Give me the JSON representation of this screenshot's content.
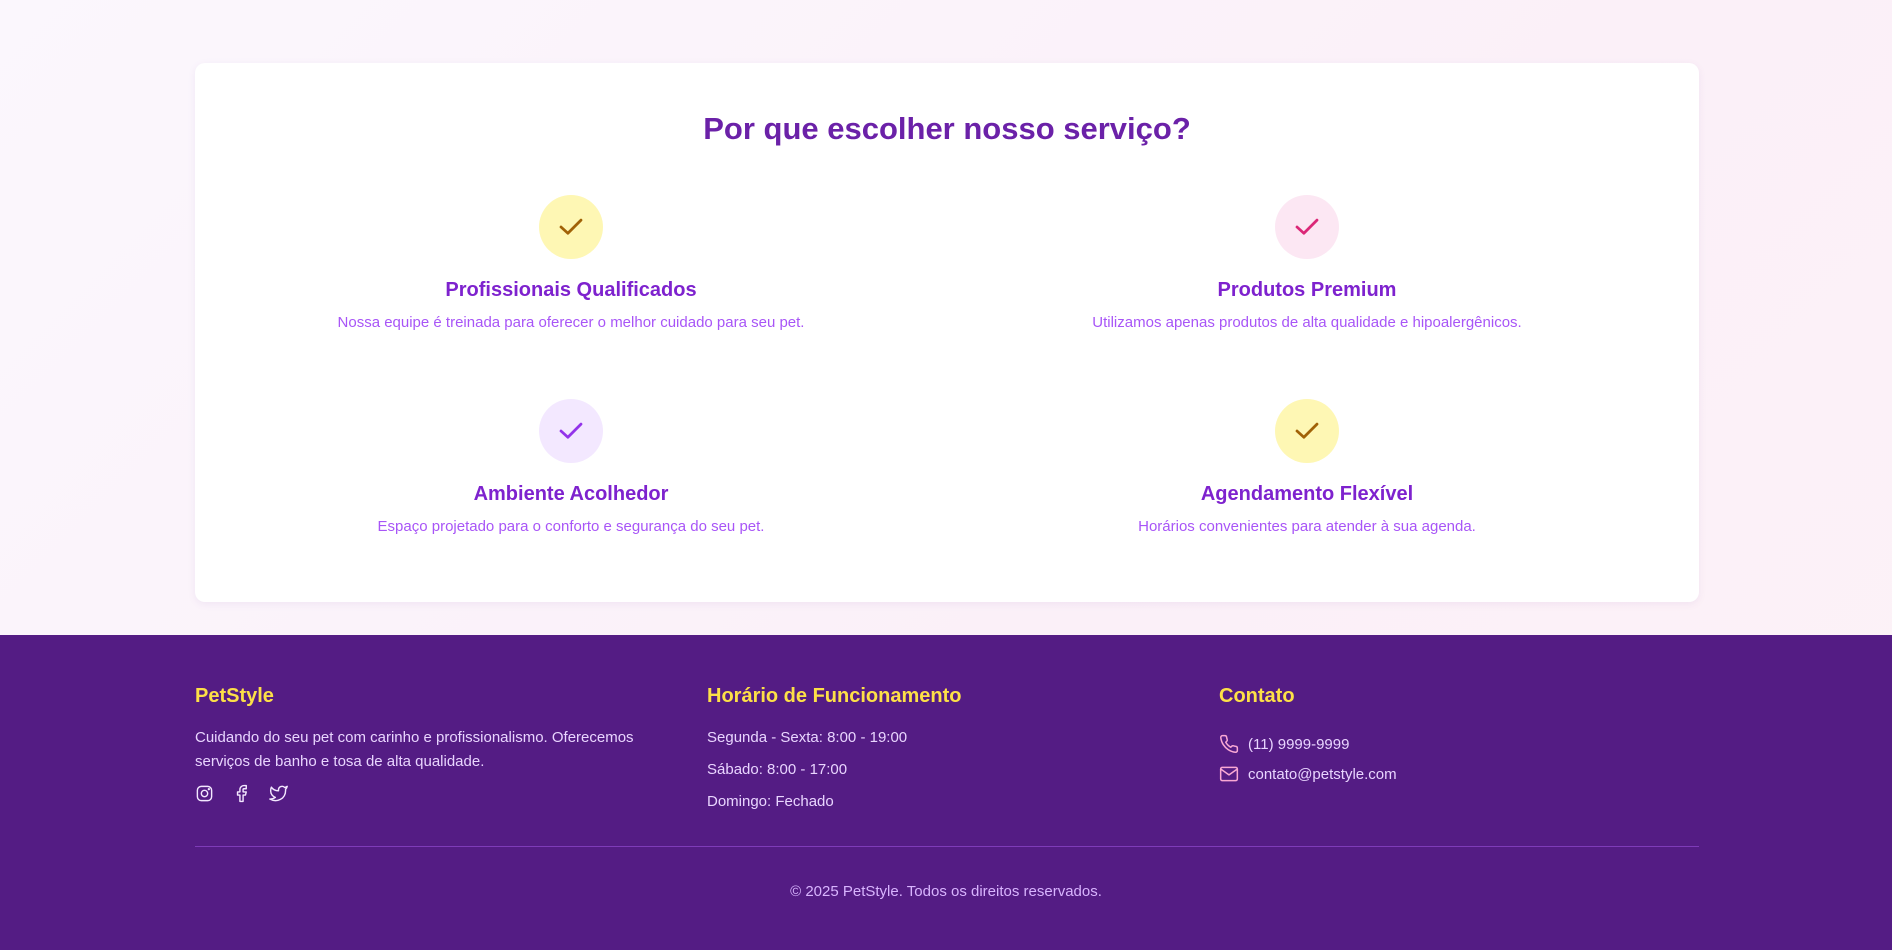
{
  "section": {
    "title": "Por que escolher nosso serviço?",
    "features": [
      {
        "title": "Profissionais Qualificados",
        "description": "Nossa equipe é treinada para oferecer o melhor cuidado para seu pet.",
        "icon": "check-icon",
        "badge_color": "#fef7b4",
        "check_color": "#a16207"
      },
      {
        "title": "Produtos Premium",
        "description": "Utilizamos apenas produtos de alta qualidade e hipoalergênicos.",
        "icon": "check-icon",
        "badge_color": "#fce7f3",
        "check_color": "#db2777"
      },
      {
        "title": "Ambiente Acolhedor",
        "description": "Espaço projetado para o conforto e segurança do seu pet.",
        "icon": "check-icon",
        "badge_color": "#f3e8ff",
        "check_color": "#9333ea"
      },
      {
        "title": "Agendamento Flexível",
        "description": "Horários convenientes para atender à sua agenda.",
        "icon": "check-icon",
        "badge_color": "#fef7b4",
        "check_color": "#a16207"
      }
    ]
  },
  "footer": {
    "brand": {
      "title": "PetStyle",
      "description": "Cuidando do seu pet com carinho e profissionalismo. Oferecemos serviços de banho e tosa de alta qualidade.",
      "socials": [
        "instagram-icon",
        "facebook-icon",
        "twitter-icon"
      ]
    },
    "hours": {
      "title": "Horário de Funcionamento",
      "lines": [
        "Segunda - Sexta: 8:00 - 19:00",
        "Sábado: 8:00 - 17:00",
        "Domingo: Fechado"
      ]
    },
    "contact": {
      "title": "Contato",
      "phone": "(11) 9999-9999",
      "email": "contato@petstyle.com"
    },
    "copyright": "© 2025 PetStyle. Todos os direitos reservados."
  },
  "colors": {
    "primary": "#6b21a8",
    "accent": "#fde047",
    "footer_bg": "#541c84"
  }
}
